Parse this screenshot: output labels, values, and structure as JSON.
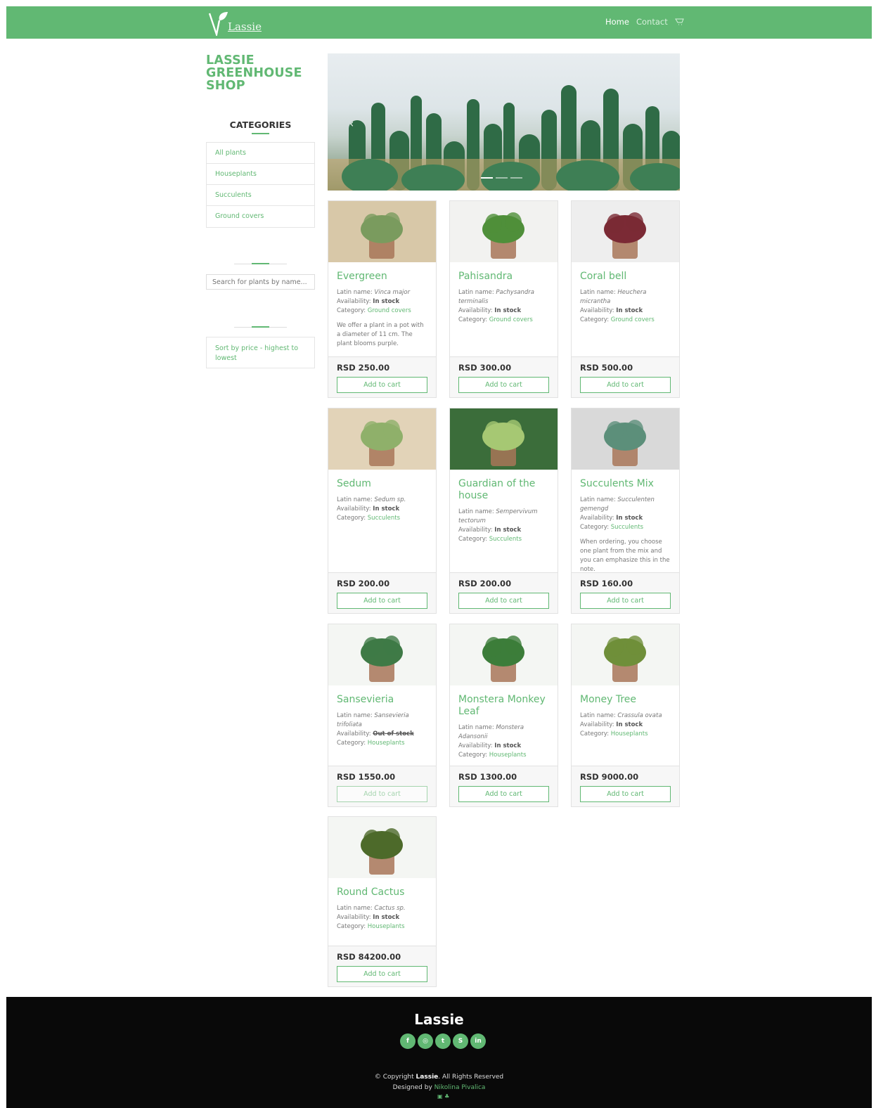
{
  "nav": {
    "logo_text": "Lassie",
    "links": [
      "Home",
      "Contact"
    ]
  },
  "sidebar": {
    "shop_title": "LASSIE GREENHOUSE SHOP",
    "categories_title": "CATEGORIES",
    "categories": [
      "All plants",
      "Houseplants",
      "Succulents",
      "Ground covers"
    ],
    "search_placeholder": "Search for plants by name...",
    "sort_label": "Sort by price - highest to lowest"
  },
  "hero": {
    "prev_icon": "chevron-left-icon",
    "slides": 3,
    "active_slide": 0
  },
  "labels": {
    "latin": "Latin name:",
    "availability": "Availability:",
    "category": "Category:",
    "add_to_cart": "Add to cart"
  },
  "products": [
    {
      "name": "Evergreen",
      "latin": "Vinca major",
      "availability": "In stock",
      "in_stock": true,
      "category": "Ground covers",
      "description": "We offer a plant in a pot with a diameter of 11 cm. The plant blooms purple.",
      "price": "RSD 250.00"
    },
    {
      "name": "Pahisandra",
      "latin": "Pachysandra terminalis",
      "availability": "In stock",
      "in_stock": true,
      "category": "Ground covers",
      "description": "",
      "price": "RSD 300.00"
    },
    {
      "name": "Coral bell",
      "latin": "Heuchera micrantha",
      "availability": "In stock",
      "in_stock": true,
      "category": "Ground covers",
      "description": "",
      "price": "RSD 500.00"
    },
    {
      "name": "Sedum",
      "latin": "Sedum sp.",
      "availability": "In stock",
      "in_stock": true,
      "category": "Succulents",
      "description": "",
      "price": "RSD 200.00"
    },
    {
      "name": "Guardian of the house",
      "latin": "Sempervivum tectorum",
      "availability": "In stock",
      "in_stock": true,
      "category": "Succulents",
      "description": "",
      "price": "RSD 200.00"
    },
    {
      "name": "Succulents Mix",
      "latin": "Succulenten gemengd",
      "availability": "In stock",
      "in_stock": true,
      "category": "Succulents",
      "description": "When ordering, you choose one plant from the mix and you can emphasize this in the note.",
      "price": "RSD 160.00"
    },
    {
      "name": "Sansevieria",
      "latin": "Sansevieria trifoliata",
      "availability": "Out of stock",
      "in_stock": false,
      "category": "Houseplants",
      "description": "",
      "price": "RSD 1550.00"
    },
    {
      "name": "Monstera Monkey Leaf",
      "latin": "Monstera Adansonii",
      "availability": "In stock",
      "in_stock": true,
      "category": "Houseplants",
      "description": "",
      "price": "RSD 1300.00"
    },
    {
      "name": "Money Tree",
      "latin": "Crassula ovata",
      "availability": "In stock",
      "in_stock": true,
      "category": "Houseplants",
      "description": "",
      "price": "RSD 9000.00"
    },
    {
      "name": "Round Cactus",
      "latin": "Cactus sp.",
      "availability": "In stock",
      "in_stock": true,
      "category": "Houseplants",
      "description": "",
      "price": "RSD 84200.00"
    }
  ],
  "footer": {
    "brand": "Lassie",
    "socials": [
      "facebook-icon",
      "instagram-icon",
      "twitter-icon",
      "skype-icon",
      "linkedin-icon"
    ],
    "social_glyphs": [
      "f",
      "◎",
      "t",
      "S",
      "in"
    ],
    "copyright_prefix": "© Copyright",
    "copyright_brand": "Lassie",
    "copyright_suffix": ". All Rights Reserved",
    "designed_by": "Designed by",
    "designer": "Nikolina Pivalica"
  },
  "colors": {
    "accent": "#61b873",
    "footer_bg": "#090909"
  }
}
